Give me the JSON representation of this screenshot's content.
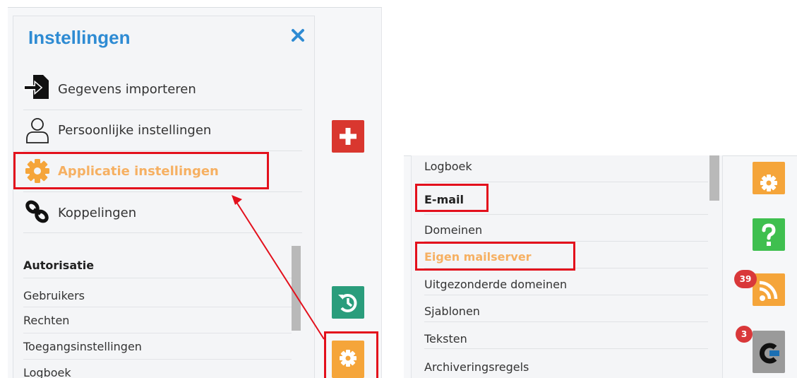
{
  "left_panel": {
    "title": "Instellingen",
    "menu_items": [
      {
        "label": "Gegevens importeren",
        "icon": "import-icon",
        "active": false
      },
      {
        "label": "Persoonlijke instellingen",
        "icon": "user-icon",
        "active": false
      },
      {
        "label": "Applicatie instellingen",
        "icon": "gear-icon",
        "active": true
      },
      {
        "label": "Koppelingen",
        "icon": "link-icon",
        "active": false
      }
    ],
    "section_title": "Autorisatie",
    "sub_items": [
      "Gebruikers",
      "Rechten",
      "Toegangsinstellingen",
      "Logboek"
    ]
  },
  "left_side_buttons": [
    {
      "icon": "plus-icon",
      "color": "#d9372f"
    },
    {
      "icon": "history-icon",
      "color": "#2a9d7c"
    },
    {
      "icon": "gear-icon",
      "color": "#f5a53a"
    }
  ],
  "right_panel": {
    "items": [
      {
        "label": "Logboek",
        "style": "normal"
      },
      {
        "label": "E-mail",
        "style": "heading"
      },
      {
        "label": "Domeinen",
        "style": "normal"
      },
      {
        "label": "Eigen mailserver",
        "style": "active"
      },
      {
        "label": "Uitgezonderde domeinen",
        "style": "normal"
      },
      {
        "label": "Sjablonen",
        "style": "normal"
      },
      {
        "label": "Teksten",
        "style": "normal"
      },
      {
        "label": "Archiveringsregels",
        "style": "normal"
      }
    ]
  },
  "right_side_buttons": [
    {
      "icon": "gear-icon",
      "color": "#f5a53a",
      "badge": ""
    },
    {
      "icon": "help-icon",
      "color": "#3fbf4f",
      "badge": ""
    },
    {
      "icon": "rss-icon",
      "color": "#f5a53a",
      "badge": "39"
    },
    {
      "icon": "app-logo-icon",
      "color": "#9a9a9a",
      "badge": "3"
    }
  ],
  "colors": {
    "accent_blue": "#2e8bd3",
    "active_orange": "#f6b062",
    "highlight_red": "#e3101c"
  }
}
